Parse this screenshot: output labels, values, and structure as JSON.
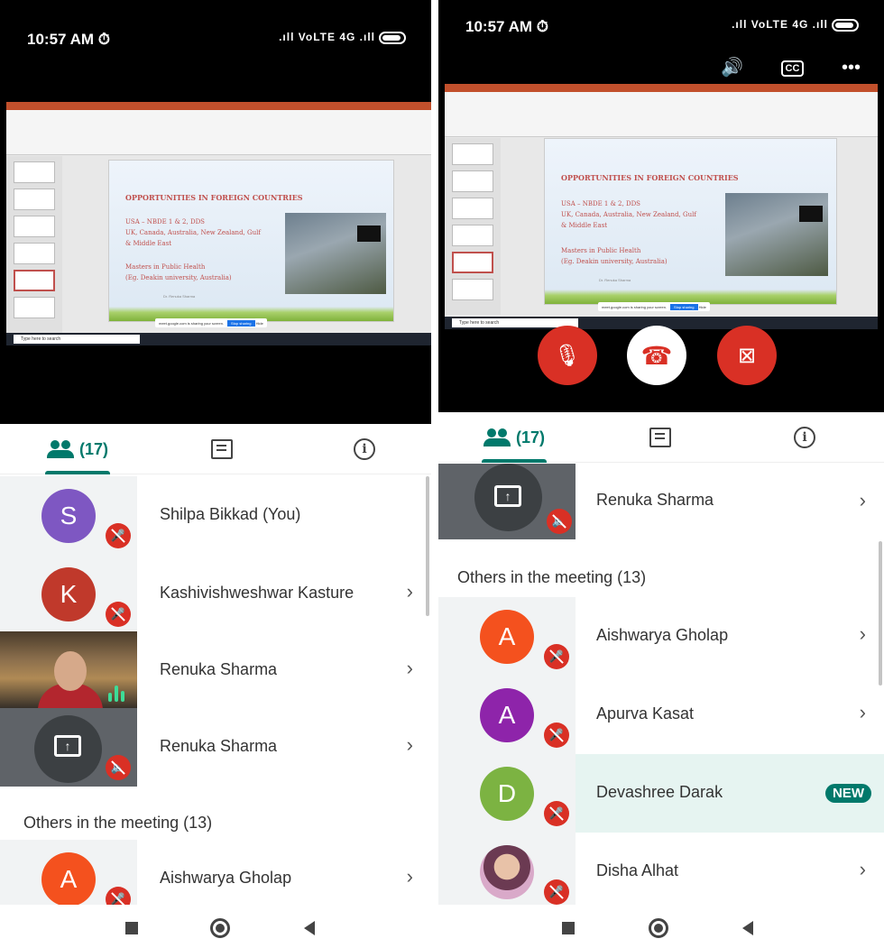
{
  "left": {
    "status": {
      "time": "10:57 AM ⏱",
      "signal": ".ıll VoLTE 4G .ıll"
    },
    "slide": {
      "title": "OPPORTUNITIES IN FOREIGN COUNTRIES",
      "lines": [
        "USA – NBDE 1 & 2, DDS",
        "UK, Canada, Australia, New Zealand, Gulf",
        "& Middle East",
        "Masters in Public Health",
        "(Eg. Deakin university, Australia)"
      ],
      "footer": "Dr. Renuka Sharma",
      "share_text": "meet.google.com is sharing your screen.",
      "stop_label": "Stop sharing",
      "hide_label": "Hide"
    },
    "taskbar_search": "Type here to search",
    "tabs": {
      "people": "(17)"
    },
    "participants": [
      {
        "initial": "S",
        "name": "Shilpa Bikkad (You)",
        "color": "#7e57c2"
      },
      {
        "initial": "K",
        "name": "Kashivishweshwar Kasture",
        "color": "#c0392b"
      },
      {
        "initial": "",
        "name": "Renuka Sharma",
        "color": ""
      },
      {
        "initial": "",
        "name": "Renuka Sharma",
        "color": ""
      }
    ],
    "others_header": "Others in the meeting (13)",
    "others": [
      {
        "initial": "A",
        "name": "Aishwarya Gholap",
        "color": "#f4511e"
      }
    ]
  },
  "right": {
    "status": {
      "time": "10:57 AM ⏱",
      "signal": ".ıll VoLTE 4G .ıll"
    },
    "cc_label": "CC",
    "slide": {
      "title": "OPPORTUNITIES IN FOREIGN COUNTRIES",
      "lines": [
        "USA – NBDE 1 & 2, DDS",
        "UK, Canada, Australia, New Zealand, Gulf",
        "& Middle East",
        "Masters in Public Health",
        "(Eg. Deakin university, Australia)"
      ],
      "footer": "Dr. Renuka Sharma",
      "share_text": "meet.google.com is sharing your screen.",
      "stop_label": "Stop sharing",
      "hide_label": "Hide"
    },
    "taskbar_search": "Type here to search",
    "tabs": {
      "people": "(17)"
    },
    "presenting": {
      "name": "Renuka Sharma"
    },
    "others_header": "Others in the meeting (13)",
    "others": [
      {
        "initial": "A",
        "name": "Aishwarya Gholap",
        "color": "#f4511e"
      },
      {
        "initial": "A",
        "name": "Apurva Kasat",
        "color": "#8e24aa"
      },
      {
        "initial": "D",
        "name": "Devashree Darak",
        "color": "#7cb342",
        "badge": "NEW"
      },
      {
        "initial": "",
        "name": "Disha Alhat",
        "color": "#c8a0c8"
      }
    ]
  },
  "colors": {
    "accent": "#00796b",
    "mute_red": "#d93025",
    "highlight": "#e6f4f1"
  }
}
